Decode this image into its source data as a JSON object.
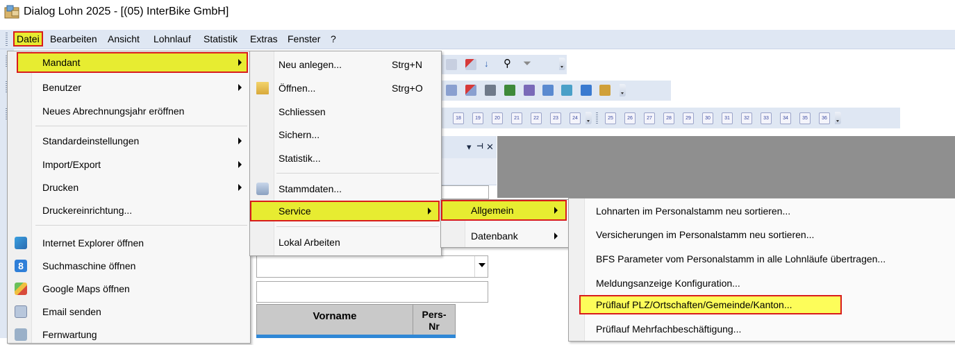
{
  "window": {
    "title": "Dialog Lohn 2025 - [(05) InterBike GmbH]",
    "icon": "app-icon"
  },
  "menubar": {
    "items": [
      "Datei",
      "Bearbeiten",
      "Ansicht",
      "Lohnlauf",
      "Statistik",
      "Extras",
      "Fenster",
      "?"
    ],
    "active": "Datei"
  },
  "colors": {
    "highlight": "#e7ec31",
    "highlight_border": "#d81c1c",
    "toolbar_bg": "#dfe7f3",
    "workspace": "#8f8f8f",
    "selected_row": "#2f87d6"
  },
  "toolbar": {
    "day_buttons": [
      "18",
      "19",
      "20",
      "21",
      "22",
      "23",
      "24",
      "25",
      "26",
      "27",
      "28",
      "29",
      "30",
      "31",
      "32",
      "33",
      "34",
      "35",
      "36"
    ]
  },
  "panel": {
    "pin_icon": "pin-icon",
    "close_label": "✕",
    "dropdown_arrow": "▾",
    "grid_headers": {
      "vorname": "Vorname",
      "persnr": "Pers-\nNr"
    }
  },
  "datei_menu": {
    "items": [
      {
        "label": "Mandant",
        "submenu": true,
        "highlighted": true
      },
      {
        "label": "Benutzer",
        "submenu": true
      },
      {
        "label": "Neues Abrechnungsjahr eröffnen"
      },
      {
        "label": "Standardeinstellungen",
        "submenu": true
      },
      {
        "label": "Import/Export",
        "submenu": true
      },
      {
        "label": "Drucken",
        "submenu": true
      },
      {
        "label": "Druckereinrichtung..."
      },
      {
        "label": "Internet Explorer öffnen",
        "icon": "internet-explorer-icon"
      },
      {
        "label": "Suchmaschine öffnen",
        "icon": "search-engine-icon"
      },
      {
        "label": "Google Maps öffnen",
        "icon": "google-maps-icon"
      },
      {
        "label": "Email senden",
        "icon": "email-icon"
      },
      {
        "label": "Fernwartung",
        "icon": "remote-maintenance-icon"
      }
    ]
  },
  "mandant_menu": {
    "items": [
      {
        "label": "Neu anlegen...",
        "shortcut": "Strg+N"
      },
      {
        "label": "Öffnen...",
        "shortcut": "Strg+O",
        "icon": "open-folder-icon"
      },
      {
        "label": "Schliessen"
      },
      {
        "label": "Sichern..."
      },
      {
        "label": "Statistik..."
      },
      {
        "label": "Stammdaten...",
        "icon": "master-data-icon"
      },
      {
        "label": "Service",
        "submenu": true,
        "highlighted": true
      },
      {
        "label": "Lokal Arbeiten"
      }
    ]
  },
  "service_menu": {
    "items": [
      {
        "label": "Allgemein",
        "submenu": true,
        "highlighted": true
      },
      {
        "label": "Datenbank",
        "submenu": true
      }
    ]
  },
  "allgemein_menu": {
    "items": [
      {
        "label": "Lohnarten im Personalstamm neu sortieren..."
      },
      {
        "label": "Versicherungen im Personalstamm neu sortieren..."
      },
      {
        "label": "BFS Parameter vom Personalstamm in alle Lohnläufe übertragen..."
      },
      {
        "label": "Meldungsanzeige Konfiguration..."
      },
      {
        "label": "Prüflauf PLZ/Ortschaften/Gemeinde/Kanton...",
        "highlighted": true
      },
      {
        "label": "Prüflauf Mehrfachbeschäftigung..."
      }
    ]
  }
}
